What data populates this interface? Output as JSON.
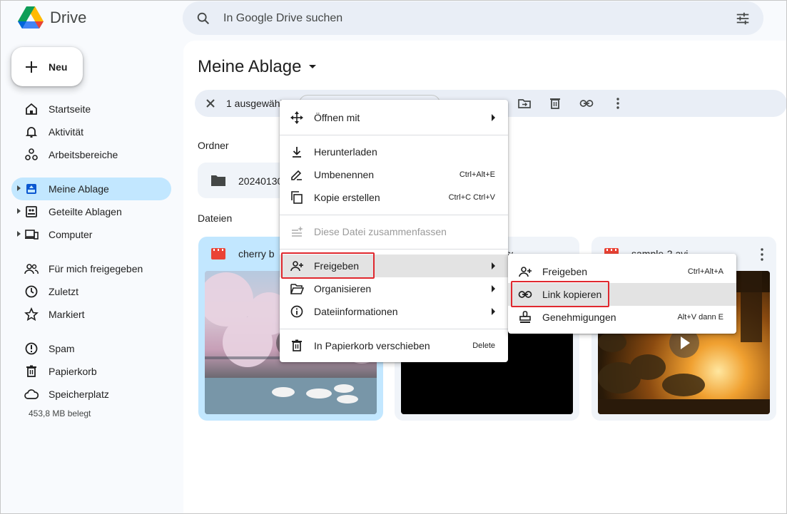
{
  "app": {
    "name": "Drive"
  },
  "search": {
    "placeholder": "In Google Drive suchen"
  },
  "sidebar": {
    "new_label": "Neu",
    "items": [
      {
        "label": "Startseite"
      },
      {
        "label": "Aktivität"
      },
      {
        "label": "Arbeitsbereiche"
      },
      {
        "label": "Meine Ablage"
      },
      {
        "label": "Geteilte Ablagen"
      },
      {
        "label": "Computer"
      },
      {
        "label": "Für mich freigegeben"
      },
      {
        "label": "Zuletzt"
      },
      {
        "label": "Markiert"
      },
      {
        "label": "Spam"
      },
      {
        "label": "Papierkorb"
      },
      {
        "label": "Speicherplatz"
      }
    ],
    "storage_used": "453,8 MB belegt"
  },
  "main": {
    "title": "Meine Ablage",
    "selection": {
      "count_label": "1 ausgewählt"
    },
    "folders_label": "Ordner",
    "folders": [
      {
        "name": "20240130"
      }
    ],
    "files_label": "Dateien",
    "files": [
      {
        "name": "cherry blossom.mp4"
      },
      {
        "name": "sample-1.mp4"
      },
      {
        "name": "sample-2.avi"
      }
    ]
  },
  "context_menu": {
    "items": [
      {
        "label": "Öffnen mit",
        "shortcut": ""
      },
      {
        "label": "Herunterladen",
        "shortcut": ""
      },
      {
        "label": "Umbenennen",
        "shortcut": "Ctrl+Alt+E"
      },
      {
        "label": "Kopie erstellen",
        "shortcut": "Ctrl+C Ctrl+V"
      },
      {
        "label": "Diese Datei zusammenfassen",
        "shortcut": ""
      },
      {
        "label": "Freigeben",
        "shortcut": ""
      },
      {
        "label": "Organisieren",
        "shortcut": ""
      },
      {
        "label": "Dateiinformationen",
        "shortcut": ""
      },
      {
        "label": "In Papierkorb verschieben",
        "shortcut": "Delete"
      }
    ]
  },
  "share_submenu": {
    "items": [
      {
        "label": "Freigeben",
        "shortcut": "Ctrl+Alt+A"
      },
      {
        "label": "Link kopieren",
        "shortcut": ""
      },
      {
        "label": "Genehmigungen",
        "shortcut": "Alt+V dann E"
      }
    ]
  },
  "colors": {
    "accent": "#c2e7ff",
    "highlight_box": "#e0282e",
    "brand_blue": "#0b57d0"
  }
}
